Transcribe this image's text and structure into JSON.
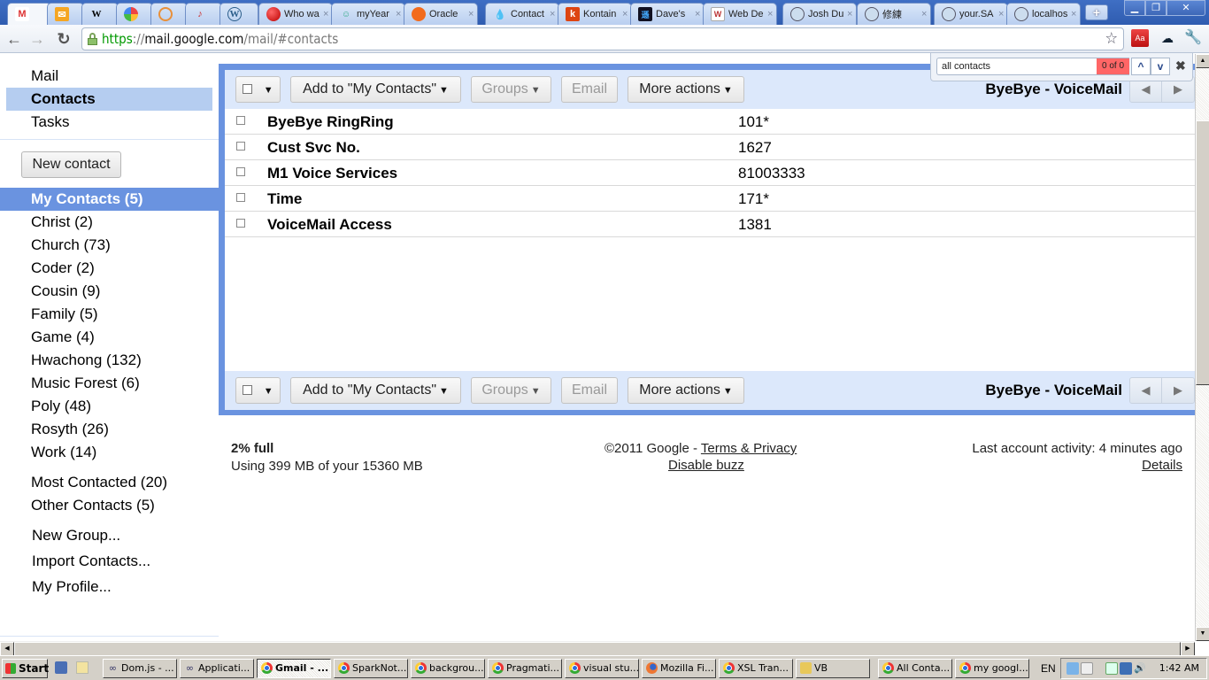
{
  "browser": {
    "tabs": [
      {
        "label": "",
        "icon": "gmail-icon",
        "active": true
      },
      {
        "label": "",
        "icon": "mail-stack-icon"
      },
      {
        "label": "",
        "icon": "wikipedia-icon"
      },
      {
        "label": "",
        "icon": "picasa-icon"
      },
      {
        "label": "",
        "icon": "swirl-icon"
      },
      {
        "label": "",
        "icon": "music-note-icon"
      },
      {
        "label": "",
        "icon": "wordpress-icon"
      },
      {
        "label": "Who wa",
        "icon": "red-ball-icon"
      },
      {
        "label": "myYear",
        "icon": "smiley-icon"
      },
      {
        "label": "Oracle",
        "icon": "oracle-icon"
      },
      {
        "label": "Contact",
        "icon": "drop-icon"
      },
      {
        "label": "Kontain",
        "icon": "k-icon"
      },
      {
        "label": "Dave's",
        "icon": "dave-icon"
      },
      {
        "label": "Web De",
        "icon": "web-dev-icon"
      },
      {
        "label": "Josh Du",
        "icon": "globe-icon"
      },
      {
        "label": "修練",
        "icon": "globe-icon"
      },
      {
        "label": "your.SA",
        "icon": "globe-icon"
      },
      {
        "label": "localhos",
        "icon": "globe-icon"
      }
    ],
    "new_tab": "+",
    "url": {
      "scheme": "https",
      "sep": "://",
      "host": "mail.google.com",
      "path": "/mail/#contacts"
    },
    "find": {
      "query": "all contacts",
      "count": "0 of 0"
    }
  },
  "sidebar": {
    "nav": [
      {
        "label": "Mail"
      },
      {
        "label": "Contacts",
        "selected": true
      },
      {
        "label": "Tasks"
      }
    ],
    "new_contact": "New contact",
    "groups": [
      {
        "label": "My Contacts (5)",
        "selected": true
      },
      {
        "label": "Christ (2)"
      },
      {
        "label": "Church (73)"
      },
      {
        "label": "Coder (2)"
      },
      {
        "label": "Cousin (9)"
      },
      {
        "label": "Family (5)"
      },
      {
        "label": "Game (4)"
      },
      {
        "label": "Hwachong (132)"
      },
      {
        "label": "Music Forest (6)"
      },
      {
        "label": "Poly (48)"
      },
      {
        "label": "Rosyth (26)"
      },
      {
        "label": "Work (14)"
      }
    ],
    "system_groups": [
      {
        "label": "Most Contacted (20)"
      },
      {
        "label": "Other Contacts (5)"
      }
    ],
    "actions": [
      {
        "label": "New Group..."
      },
      {
        "label": "Import Contacts..."
      },
      {
        "label": "My Profile..."
      }
    ]
  },
  "toolbar": {
    "select_caret": "▼",
    "add_to": "Add to \"My Contacts\"",
    "groups": "Groups",
    "email": "Email",
    "more_actions": "More actions",
    "caret": "▼",
    "pager_label": "ByeBye - VoiceMail",
    "prev": "◀",
    "next": "▶"
  },
  "contacts": [
    {
      "name": "ByeBye RingRing",
      "phone": "101*"
    },
    {
      "name": "Cust Svc No.",
      "phone": "1627"
    },
    {
      "name": "M1 Voice Services",
      "phone": "81003333"
    },
    {
      "name": "Time",
      "phone": "171*"
    },
    {
      "name": "VoiceMail Access",
      "phone": "1381"
    }
  ],
  "footer": {
    "usage_percent": "2% full",
    "usage_detail": "Using 399 MB of your 15360 MB",
    "copyright": "©2011 Google - ",
    "terms": "Terms & Privacy",
    "disable_buzz": "Disable buzz",
    "last_activity": "Last account activity: 4 minutes ago",
    "details": "Details"
  },
  "taskbar": {
    "start": "Start",
    "tasks": [
      {
        "label": "Dom.js - ...",
        "icon": "infinity-icon"
      },
      {
        "label": "Applicati...",
        "icon": "infinity-icon"
      },
      {
        "label": "Gmail - ...",
        "icon": "chrome-icon",
        "active": true
      },
      {
        "label": "SparkNot...",
        "icon": "chrome-icon"
      },
      {
        "label": "backgrou...",
        "icon": "chrome-icon"
      },
      {
        "label": "Pragmati...",
        "icon": "chrome-icon"
      },
      {
        "label": "visual stu...",
        "icon": "chrome-icon"
      },
      {
        "label": "Mozilla Fi...",
        "icon": "firefox-icon"
      },
      {
        "label": "XSL Tran...",
        "icon": "chrome-icon"
      },
      {
        "label": "VB",
        "icon": "folder-icon"
      },
      {
        "label": "All Conta...",
        "icon": "chrome-icon"
      },
      {
        "label": "my googl...",
        "icon": "chrome-icon"
      }
    ],
    "language": "EN",
    "clock": "1:42 AM"
  }
}
